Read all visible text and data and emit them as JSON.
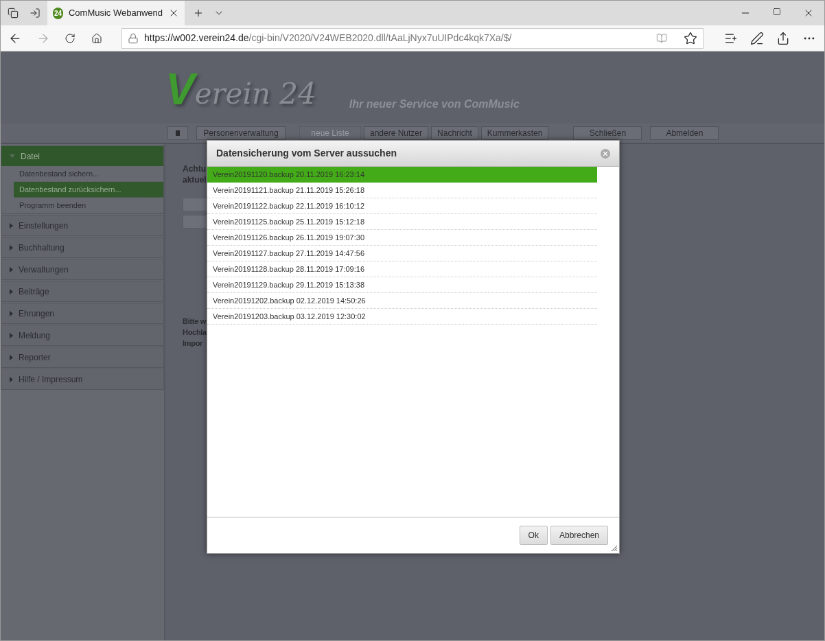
{
  "browser": {
    "tab": {
      "title": "ComMusic Webanwend",
      "favicon": "24"
    },
    "url": {
      "host": "https://w002.verein24.de",
      "path": "/cgi-bin/V2020/V24WEB2020.dll/tAaLjNyx7uUIPdc4kqk7Xa/$/"
    }
  },
  "header": {
    "logo_initial": "V",
    "logo_rest": "erein 24",
    "slogan": "Ihr neuer Service von ComMusic"
  },
  "toolbar": [
    {
      "label": "Personenverwaltung",
      "disabled": false
    },
    {
      "label": "neue Liste",
      "disabled": true
    },
    {
      "label": "andere Nutzer",
      "disabled": false
    },
    {
      "label": "Nachricht",
      "disabled": false
    },
    {
      "label": "Kummerkasten",
      "disabled": false
    },
    {
      "label": "Schließen",
      "disabled": false
    },
    {
      "label": "Abmelden",
      "disabled": false
    }
  ],
  "sidebar": [
    {
      "label": "Datei",
      "expanded": true,
      "children": [
        {
          "label": "Datenbestand sichern...",
          "selected": false
        },
        {
          "label": "Datenbestand zurücksichern...",
          "selected": true
        },
        {
          "label": "Programm beenden",
          "selected": false
        }
      ]
    },
    {
      "label": "Einstellungen",
      "expanded": false
    },
    {
      "label": "Buchhaltung",
      "expanded": false
    },
    {
      "label": "Verwaltungen",
      "expanded": false
    },
    {
      "label": "Beiträge",
      "expanded": false
    },
    {
      "label": "Ehrungen",
      "expanded": false
    },
    {
      "label": "Meldung",
      "expanded": false
    },
    {
      "label": "Reporter",
      "expanded": false
    },
    {
      "label": "Hilfe / Impressum",
      "expanded": false
    }
  ],
  "content": {
    "top_text": [
      "Achtu",
      "aktuel"
    ],
    "bottom_text": [
      "Bitte w",
      "Hochla",
      "Impor"
    ]
  },
  "dialog": {
    "title": "Datensicherung vom Server aussuchen",
    "rows": [
      {
        "label": "Verein20191120.backup 20.11.2019 16:23:14",
        "selected": true
      },
      {
        "label": "Verein20191121.backup 21.11.2019 15:26:18",
        "selected": false
      },
      {
        "label": "Verein20191122.backup 22.11.2019 16:10:12",
        "selected": false
      },
      {
        "label": "Verein20191125.backup 25.11.2019 15:12:18",
        "selected": false
      },
      {
        "label": "Verein20191126.backup 26.11.2019 19:07:30",
        "selected": false
      },
      {
        "label": "Verein20191127.backup 27.11.2019 14:47:56",
        "selected": false
      },
      {
        "label": "Verein20191128.backup 28.11.2019 17:09:16",
        "selected": false
      },
      {
        "label": "Verein20191129.backup 29.11.2019 15:13:38",
        "selected": false
      },
      {
        "label": "Verein20191202.backup 02.12.2019 14:50:26",
        "selected": false
      },
      {
        "label": "Verein20191203.backup 03.12.2019 12:30:02",
        "selected": false
      }
    ],
    "buttons": [
      "Ok",
      "Abbrechen"
    ]
  }
}
